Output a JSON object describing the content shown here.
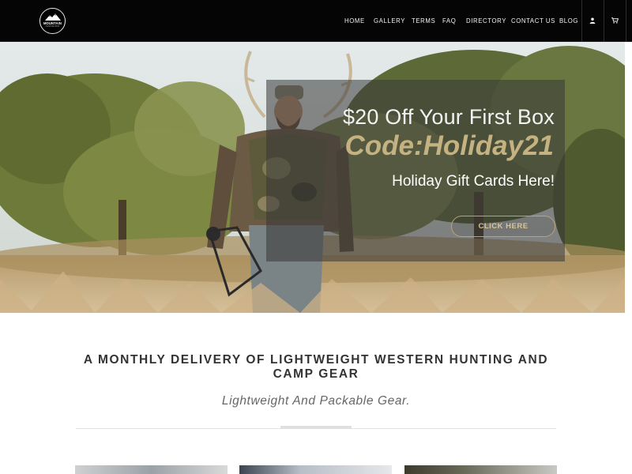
{
  "header": {
    "logo": {
      "brand": "MOUNTAIN",
      "tagline": "HUNTING BOX"
    },
    "nav": [
      {
        "label": "HOME"
      },
      {
        "label": "GALLERY"
      },
      {
        "label": "TERMS"
      },
      {
        "label": "FAQ"
      },
      {
        "label": "DIRECTORY"
      },
      {
        "label": "CONTACT US"
      },
      {
        "label": "BLOG"
      }
    ],
    "icons": {
      "account": "user-icon",
      "cart": "cart-icon"
    }
  },
  "hero": {
    "promo": "$20 Off Your First Box",
    "code": "Code:Holiday21",
    "gift_link": "Holiday Gift Cards Here!",
    "cta": "CLICK HERE",
    "colors": {
      "code": "#c5b283",
      "cta_border": "#b8a47a"
    }
  },
  "main": {
    "title": "A MONTHLY DELIVERY OF LIGHTWEIGHT WESTERN HUNTING AND CAMP GEAR",
    "subtitle": "Lightweight And Packable Gear."
  }
}
